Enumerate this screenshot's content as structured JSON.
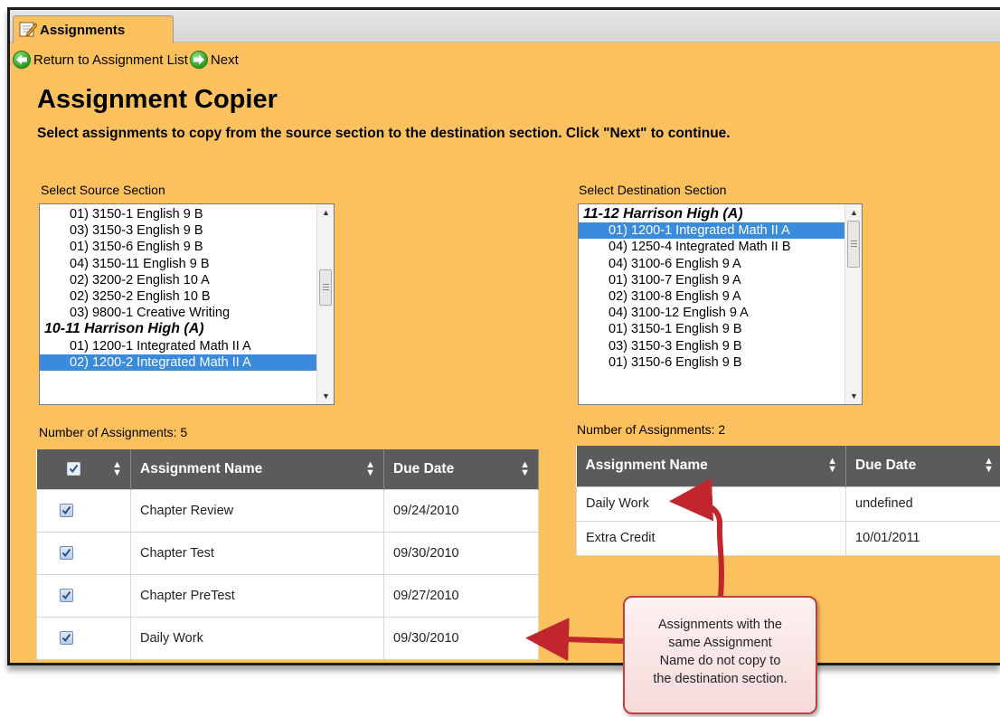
{
  "tab": {
    "label": "Assignments"
  },
  "nav": {
    "return_label": "Return to Assignment List",
    "next_label": "Next"
  },
  "page": {
    "title": "Assignment Copier",
    "instructions": "Select assignments to copy from the source section to the destination section. Click \"Next\" to continue."
  },
  "source": {
    "label": "Select Source Section",
    "items": [
      {
        "text": "01) 3150-1 English 9 B",
        "group": false,
        "selected": false
      },
      {
        "text": "03) 3150-3 English 9 B",
        "group": false,
        "selected": false
      },
      {
        "text": "01) 3150-6 English 9 B",
        "group": false,
        "selected": false
      },
      {
        "text": "04) 3150-11 English 9 B",
        "group": false,
        "selected": false
      },
      {
        "text": "02) 3200-2 English 10 A",
        "group": false,
        "selected": false
      },
      {
        "text": "02) 3250-2 English 10 B",
        "group": false,
        "selected": false
      },
      {
        "text": "03) 9800-1 Creative Writing",
        "group": false,
        "selected": false
      },
      {
        "text": "10-11 Harrison High (A)",
        "group": true,
        "selected": false
      },
      {
        "text": "01) 1200-1 Integrated Math II A",
        "group": false,
        "selected": false
      },
      {
        "text": "02) 1200-2 Integrated Math II A",
        "group": false,
        "selected": true
      }
    ],
    "count_label": "Number of Assignments: 5",
    "table": {
      "headers": [
        "Assignment Name",
        "Due Date"
      ],
      "rows": [
        {
          "name": "Chapter Review",
          "due": "09/24/2010",
          "checked": true
        },
        {
          "name": "Chapter Test",
          "due": "09/30/2010",
          "checked": true
        },
        {
          "name": "Chapter PreTest",
          "due": "09/27/2010",
          "checked": true
        },
        {
          "name": "Daily Work",
          "due": "09/30/2010",
          "checked": true
        }
      ]
    }
  },
  "destination": {
    "label": "Select Destination Section",
    "items": [
      {
        "text": "11-12 Harrison High (A)",
        "group": true,
        "selected": false
      },
      {
        "text": "01) 1200-1 Integrated Math II A",
        "group": false,
        "selected": true
      },
      {
        "text": "04) 1250-4 Integrated Math II B",
        "group": false,
        "selected": false
      },
      {
        "text": "04) 3100-6 English 9 A",
        "group": false,
        "selected": false
      },
      {
        "text": "01) 3100-7 English 9 A",
        "group": false,
        "selected": false
      },
      {
        "text": "02) 3100-8 English 9 A",
        "group": false,
        "selected": false
      },
      {
        "text": "04) 3100-12 English 9 A",
        "group": false,
        "selected": false
      },
      {
        "text": "01) 3150-1 English 9 B",
        "group": false,
        "selected": false
      },
      {
        "text": "03) 3150-3 English 9 B",
        "group": false,
        "selected": false
      },
      {
        "text": "01) 3150-6 English 9 B",
        "group": false,
        "selected": false
      }
    ],
    "count_label": "Number of Assignments: 2",
    "table": {
      "headers": [
        "Assignment Name",
        "Due Date"
      ],
      "rows": [
        {
          "name": "Daily Work",
          "due": "undefined"
        },
        {
          "name": "Extra Credit",
          "due": "10/01/2011"
        }
      ]
    }
  },
  "callout": {
    "lines": [
      "Assignments with the",
      "same Assignment",
      "Name do not copy to",
      "the destination section."
    ]
  },
  "colors": {
    "panel_background": "#fbc15e",
    "header_background": "#5b5b5b",
    "selection": "#3a8bdc",
    "arrow": "#c0262c"
  }
}
